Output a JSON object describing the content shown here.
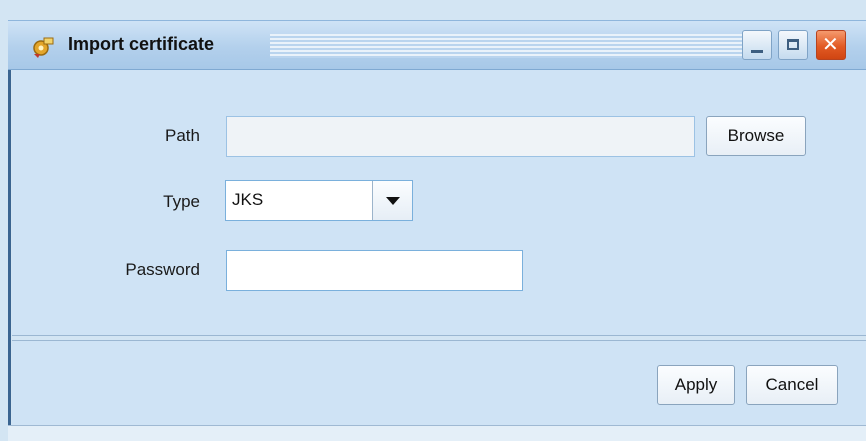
{
  "window": {
    "title": "Import certificate",
    "icon": "gear-certificate-icon",
    "controls": {
      "minimize": "minimize-icon",
      "maximize": "maximize-icon",
      "close": "close-icon"
    }
  },
  "form": {
    "path": {
      "label": "Path",
      "value": "",
      "browse_label": "Browse"
    },
    "type": {
      "label": "Type",
      "selected": "JKS"
    },
    "password": {
      "label": "Password",
      "value": ""
    }
  },
  "actions": {
    "apply_label": "Apply",
    "cancel_label": "Cancel"
  },
  "colors": {
    "panel": "#cfe3f5",
    "titlebar": "#b3d0ec",
    "close_button": "#e25a24",
    "field_border": "#7ab0dc"
  }
}
